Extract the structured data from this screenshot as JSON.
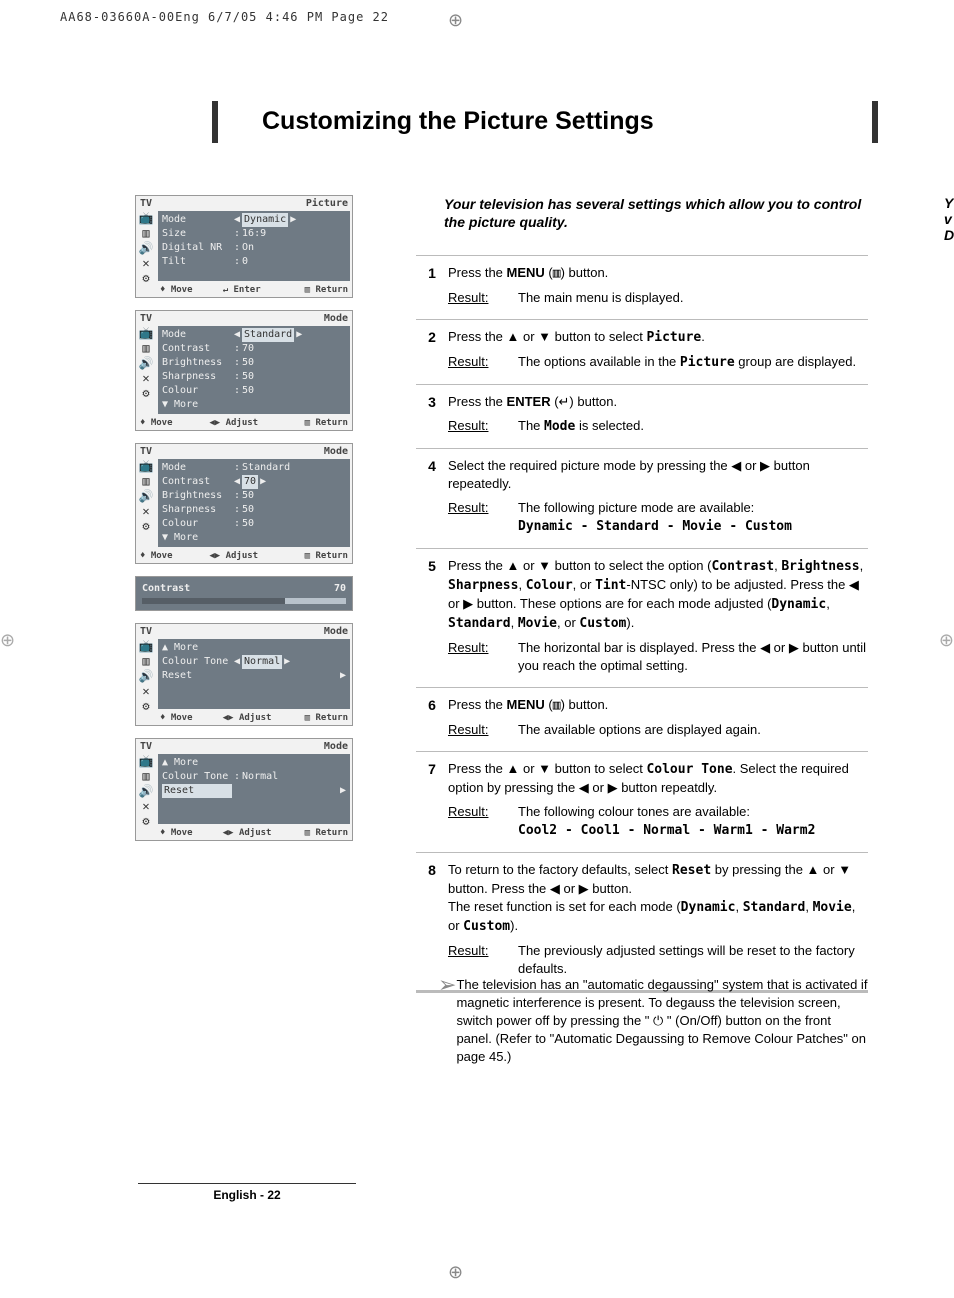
{
  "header_line": "AA68-03660A-00Eng  6/7/05  4:46 PM  Page 22",
  "title": "Customizing the Picture Settings",
  "intro": "Your television has several settings which allow you to control the picture quality.",
  "sidecut": "Y\nv\nD",
  "steps": [
    {
      "num": "1",
      "text_html": "Press the <b>MENU</b> (<span class='mono'>▥</span>) button.",
      "result": "The main menu is displayed."
    },
    {
      "num": "2",
      "text_html": "Press the ▲ or ▼ button to select <span class='mono'>Picture</span>.",
      "result_html": "The options available in the <span class='mono'>Picture</span> group are displayed."
    },
    {
      "num": "3",
      "text_html": "Press the <b>ENTER</b> (↵) button.",
      "result_html": "The <span class='mono'>Mode</span> is selected."
    },
    {
      "num": "4",
      "text_html": "Select the required picture mode by pressing the ◀ or ▶ button repeatedly.",
      "result_html": "The following picture mode are available:",
      "result_extra": "Dynamic - Standard - Movie - Custom"
    },
    {
      "num": "5",
      "text_html": "Press the ▲ or ▼ button to select the option (<span class='mono'>Contrast</span>, <span class='mono'>Brightness</span>, <span class='mono'>Sharpness</span>, <span class='mono'>Colour</span>, or <span class='mono'>Tint</span>-NTSC only) to be adjusted. Press the ◀ or ▶ button. These options are for each mode adjusted (<span class='mono'>Dynamic</span>, <span class='mono'>Standard</span>, <span class='mono'>Movie</span>, or <span class='mono'>Custom</span>).",
      "result_html": "The horizontal bar is displayed. Press the ◀ or ▶ button until you reach the optimal setting."
    },
    {
      "num": "6",
      "text_html": "Press the <b>MENU</b> (<span class='mono'>▥</span>) button.",
      "result": "The available options are displayed again."
    },
    {
      "num": "7",
      "text_html": "Press the ▲ or ▼ button to select <span class='mono'>Colour Tone</span>. Select the required option by pressing the ◀ or ▶ button repeatdly.",
      "result_html": "The following colour tones are available:",
      "result_extra": "Cool2 - Cool1 - Normal - Warm1 - Warm2"
    },
    {
      "num": "8",
      "text_html": "To return to the factory defaults, select <span class='mono'>Reset</span> by pressing the ▲ or ▼ button. Press the ◀ or ▶ button.<br>The reset function is set for each mode (<span class='mono'>Dynamic</span>, <span class='mono'>Standard</span>, <span class='mono'>Movie</span>, or <span class='mono'>Custom</span>).",
      "result_html": "The previously adjusted settings will be reset to the factory defaults."
    }
  ],
  "note": "The television has an \"automatic degaussing\" system that is activated if magnetic interference is present.  To degauss the television screen, switch power off by pressing the \" ⏻ \" (On/Off) button on the front panel. (Refer to \"Automatic Degaussing to Remove Colour Patches\" on page 45.)",
  "result_label": "Result:",
  "page_footer": "English - 22",
  "osd": {
    "icons": [
      "📺",
      "▥",
      "🔊",
      "✕",
      "⚙"
    ],
    "move": "Move",
    "enter": "Enter",
    "adjust": "Adjust",
    "return": "Return",
    "screen1": {
      "tv": "TV",
      "title": "Picture",
      "rows": [
        {
          "l": "Mode",
          "sep": "◀",
          "v": "Dynamic",
          "arr": "▶"
        },
        {
          "l": "Size",
          "sep": ":",
          "v": "16:9"
        },
        {
          "l": "Digital NR",
          "sep": ":",
          "v": "On"
        },
        {
          "l": "Tilt",
          "sep": ":",
          "v": "0"
        }
      ]
    },
    "screen2": {
      "tv": "TV",
      "title": "Mode",
      "rows": [
        {
          "l": "Mode",
          "sep": "◀",
          "v": "Standard",
          "arr": "▶"
        },
        {
          "l": "Contrast",
          "sep": ":",
          "v": "70"
        },
        {
          "l": "Brightness",
          "sep": ":",
          "v": "50"
        },
        {
          "l": "Sharpness",
          "sep": ":",
          "v": "50"
        },
        {
          "l": "Colour",
          "sep": ":",
          "v": "50"
        },
        {
          "l": "▼ More"
        }
      ]
    },
    "screen3": {
      "tv": "TV",
      "title": "Mode",
      "rows": [
        {
          "l": "Mode",
          "sep": ":",
          "v": "Standard"
        },
        {
          "l": "Contrast",
          "sep": "◀",
          "v": "70",
          "arr": "▶"
        },
        {
          "l": "Brightness",
          "sep": ":",
          "v": "50"
        },
        {
          "l": "Sharpness",
          "sep": ":",
          "v": "50"
        },
        {
          "l": "Colour",
          "sep": ":",
          "v": "50"
        },
        {
          "l": "▼ More"
        }
      ]
    },
    "bar": {
      "label": "Contrast",
      "value": "70",
      "pct": 70
    },
    "screen4": {
      "tv": "TV",
      "title": "Mode",
      "rows": [
        {
          "l": "▲ More"
        },
        {
          "l": "Colour Tone",
          "sep": "◀",
          "v": "Normal",
          "arr": "▶"
        },
        {
          "l": "Reset",
          "arr": "▶"
        }
      ]
    },
    "screen5": {
      "tv": "TV",
      "title": "Mode",
      "rows": [
        {
          "l": "▲ More"
        },
        {
          "l": "Colour Tone",
          "sep": ":",
          "v": "Normal"
        },
        {
          "l": "Reset",
          "arr": "▶",
          "hl": true
        }
      ]
    }
  }
}
